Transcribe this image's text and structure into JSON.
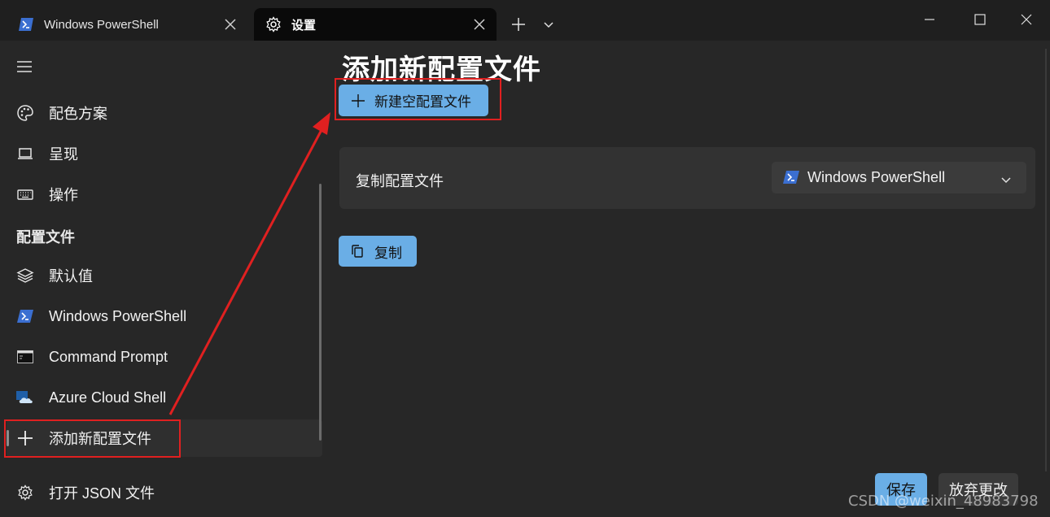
{
  "titlebar": {
    "tabs": [
      {
        "label": "Windows PowerShell",
        "icon": "powershell-icon"
      },
      {
        "label": "设置",
        "icon": "gear-icon"
      }
    ]
  },
  "sidebar": {
    "items": [
      {
        "label": "配色方案",
        "icon": "palette-icon"
      },
      {
        "label": "呈现",
        "icon": "laptop-icon"
      },
      {
        "label": "操作",
        "icon": "keyboard-icon"
      }
    ],
    "section_header": "配置文件",
    "profiles": [
      {
        "label": "默认值",
        "icon": "layers-icon"
      },
      {
        "label": "Windows PowerShell",
        "icon": "powershell-icon"
      },
      {
        "label": "Command Prompt",
        "icon": "cmd-icon"
      },
      {
        "label": "Azure Cloud Shell",
        "icon": "azure-cloud-icon"
      },
      {
        "label": "添加新配置文件",
        "icon": "plus-icon",
        "selected": true
      }
    ],
    "footer_item": {
      "label": "打开 JSON 文件",
      "icon": "gear-icon"
    }
  },
  "main": {
    "title": "添加新配置文件",
    "new_empty_button": "新建空配置文件",
    "duplicate_label": "复制配置文件",
    "duplicate_selected": "Windows PowerShell",
    "copy_button": "复制"
  },
  "footer": {
    "save_button": "保存",
    "discard_button": "放弃更改"
  },
  "watermark": "CSDN @weixin_48983798",
  "colors": {
    "accent": "#6aaee6",
    "annotation": "#e02020",
    "background": "#272727",
    "titlebar": "#1f1f1f"
  }
}
